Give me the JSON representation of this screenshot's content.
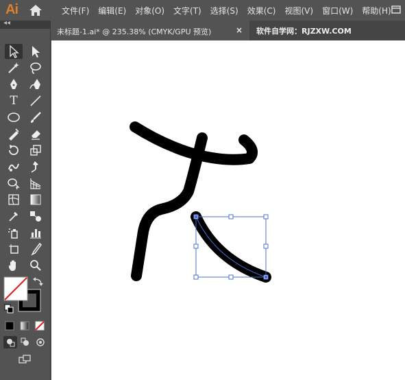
{
  "app": {
    "logo_text": "Ai"
  },
  "menu": [
    "文件(F)",
    "编辑(E)",
    "对象(O)",
    "文字(T)",
    "选择(S)",
    "效果(C)",
    "视图(V)",
    "窗口(W)",
    "帮助(H)"
  ],
  "document_tab": {
    "title": "未标题-1.ai* @ 235.38% (CMYK/GPU 预览)",
    "close_glyph": "×"
  },
  "watermark": "软件自学网：RJZXW.COM",
  "toolbar": {
    "collapse_glyph": "◂◂",
    "type_tool_glyph": "T"
  },
  "colors": {
    "ui_background": "#535353",
    "canvas": "#ffffff",
    "stroke": "#000000",
    "selection": "#4a6cd4",
    "logo": "#d9822b"
  }
}
